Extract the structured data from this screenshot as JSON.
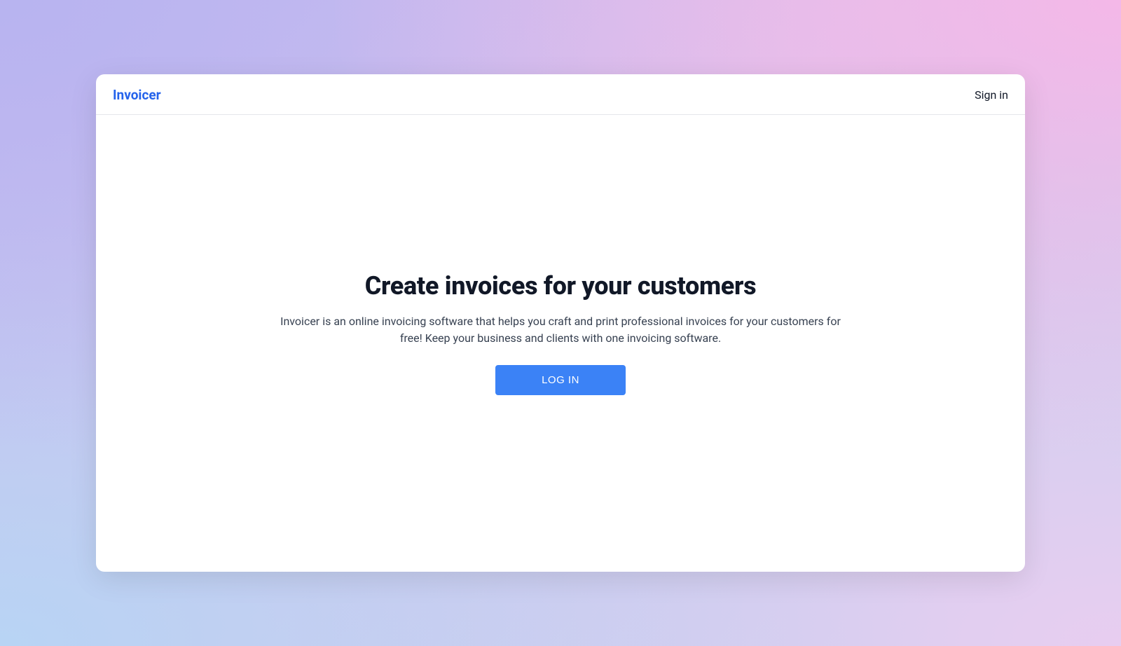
{
  "header": {
    "logo": "Invoicer",
    "signin": "Sign in"
  },
  "main": {
    "heading": "Create invoices for your customers",
    "description": "Invoicer is an online invoicing software that helps you craft and print professional invoices for your customers for free! Keep your business and clients with one invoicing software.",
    "login_button": "LOG IN"
  },
  "colors": {
    "accent": "#2563eb",
    "button": "#3b82f6",
    "text_primary": "#111827",
    "text_secondary": "#374151",
    "border": "#e5e7eb"
  }
}
